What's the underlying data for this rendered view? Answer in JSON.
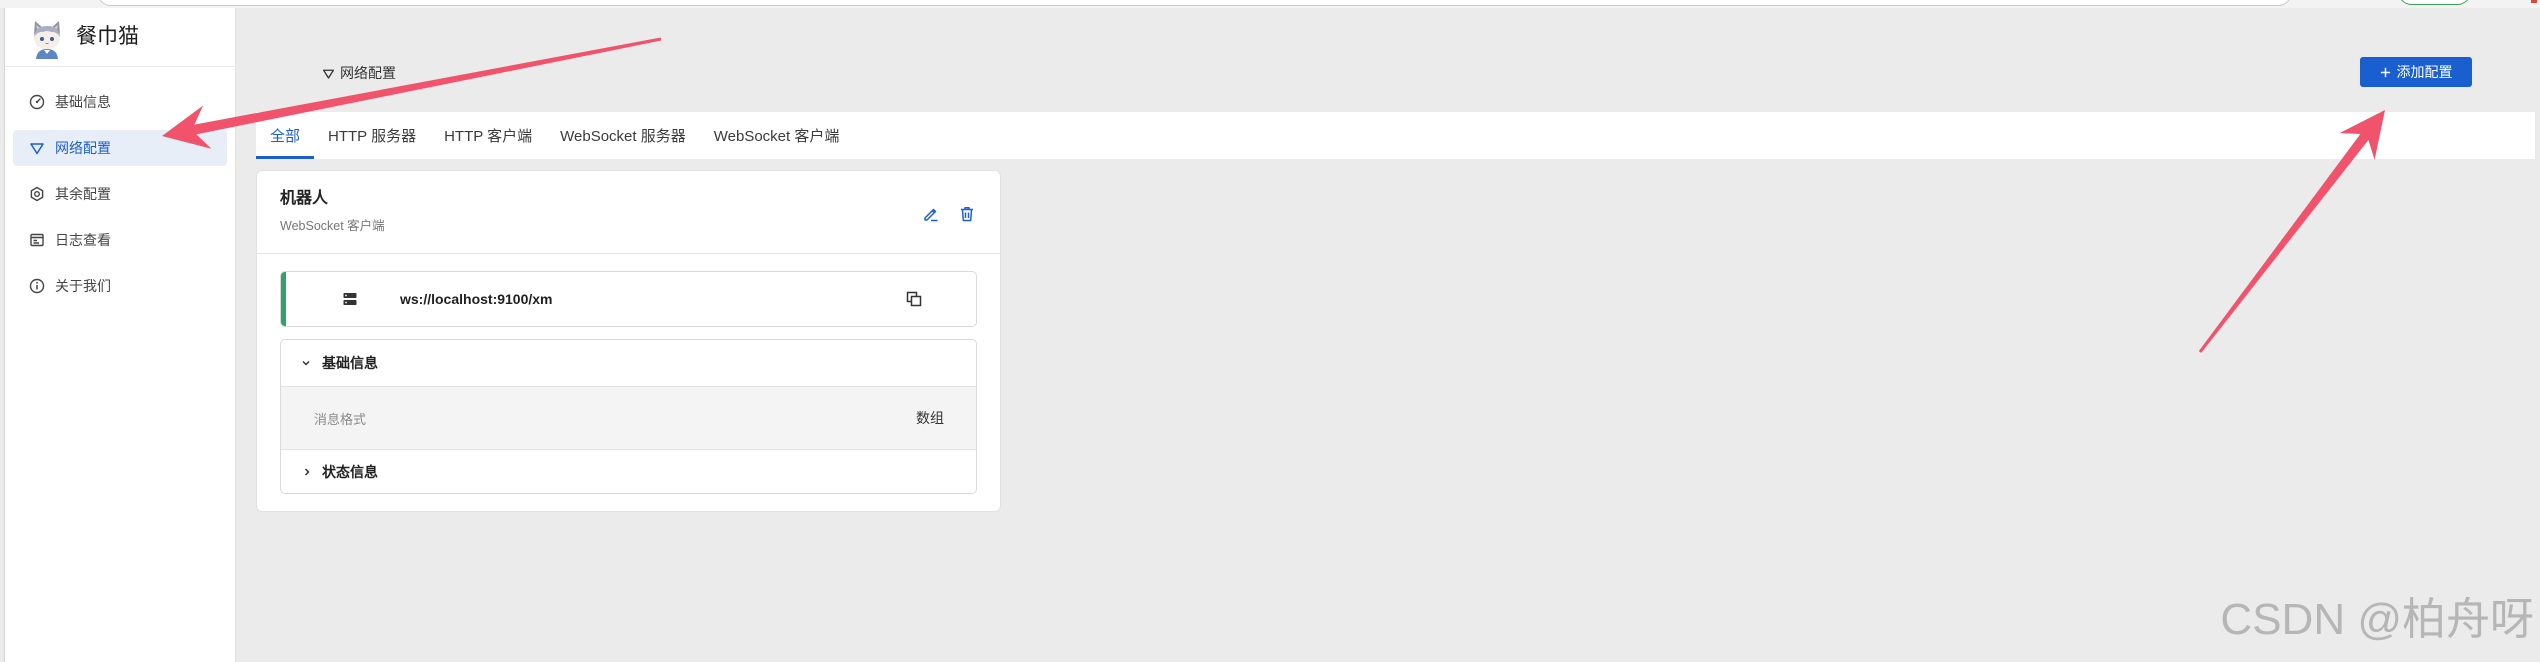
{
  "colors": {
    "accent": "#1a5fd0",
    "status": "#2fa36b",
    "annotation": "#f1536c"
  },
  "sidebar": {
    "app_name": "餐巾猫",
    "logo_icon": "cat-avatar-icon",
    "items": [
      {
        "label": "基础信息",
        "icon": "dashboard-icon",
        "active": false
      },
      {
        "label": "网络配置",
        "icon": "network-icon",
        "active": true
      },
      {
        "label": "其余配置",
        "icon": "settings-icon",
        "active": false
      },
      {
        "label": "日志查看",
        "icon": "log-icon",
        "active": false
      },
      {
        "label": "关于我们",
        "icon": "info-icon",
        "active": false
      }
    ]
  },
  "header": {
    "title": "网络配置",
    "title_icon": "network-icon",
    "add_button": {
      "label": "添加配置",
      "icon": "plus-icon"
    }
  },
  "tabs": [
    {
      "label": "全部",
      "active": true
    },
    {
      "label": "HTTP 服务器",
      "active": false
    },
    {
      "label": "HTTP 客户端",
      "active": false
    },
    {
      "label": "WebSocket 服务器",
      "active": false
    },
    {
      "label": "WebSocket 客户端",
      "active": false
    }
  ],
  "cards": [
    {
      "title": "机器人",
      "subtitle": "WebSocket 客户端",
      "actions": [
        {
          "icon": "edit-icon"
        },
        {
          "icon": "delete-icon"
        }
      ],
      "endpoint": {
        "icon": "server-icon",
        "url": "ws://localhost:9100/xm",
        "copy_icon": "copy-icon"
      },
      "sections": [
        {
          "title": "基础信息",
          "expanded": true,
          "rows": [
            {
              "label": "消息格式",
              "value": "数组"
            }
          ]
        },
        {
          "title": "状态信息",
          "expanded": false,
          "rows": []
        }
      ]
    }
  ],
  "watermark": "CSDN @柏舟呀"
}
